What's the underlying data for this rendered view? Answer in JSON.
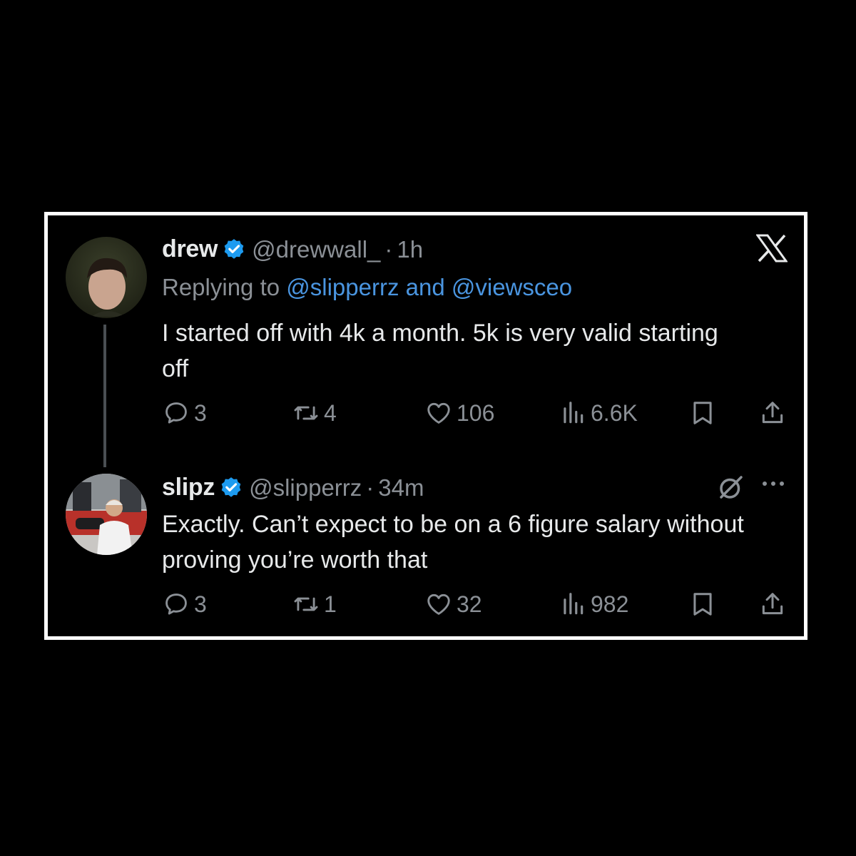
{
  "tweets": [
    {
      "name": "drew",
      "handle": "@drewwall_",
      "separator": "·",
      "time": "1h",
      "replying_prefix": "Replying to ",
      "replying_to_1": "@slipperrz",
      "replying_and": " and ",
      "replying_to_2": "@viewsceo",
      "text": "I started off with 4k a month. 5k is very valid starting off",
      "replies": "3",
      "retweets": "4",
      "likes": "106",
      "views": "6.6K"
    },
    {
      "name": "slipz",
      "handle": "@slipperrz",
      "separator": "·",
      "time": "34m",
      "text": "Exactly. Can’t expect to be on a 6 figure salary without proving you’re worth that",
      "replies": "3",
      "retweets": "1",
      "likes": "32",
      "views": "982"
    }
  ],
  "icons": {
    "logo": "x-logo-icon",
    "verified": "verified-badge-icon",
    "reply": "reply-icon",
    "retweet": "retweet-icon",
    "like": "heart-icon",
    "views": "views-icon",
    "bookmark": "bookmark-icon",
    "share": "share-icon",
    "grok": "grok-icon",
    "more": "more-icon"
  },
  "colors": {
    "background": "#000000",
    "frame_border": "#ffffff",
    "text_primary": "#e7e9ea",
    "text_secondary": "#8b9096",
    "mention": "#4a95e0",
    "verified": "#1d9bf0"
  }
}
